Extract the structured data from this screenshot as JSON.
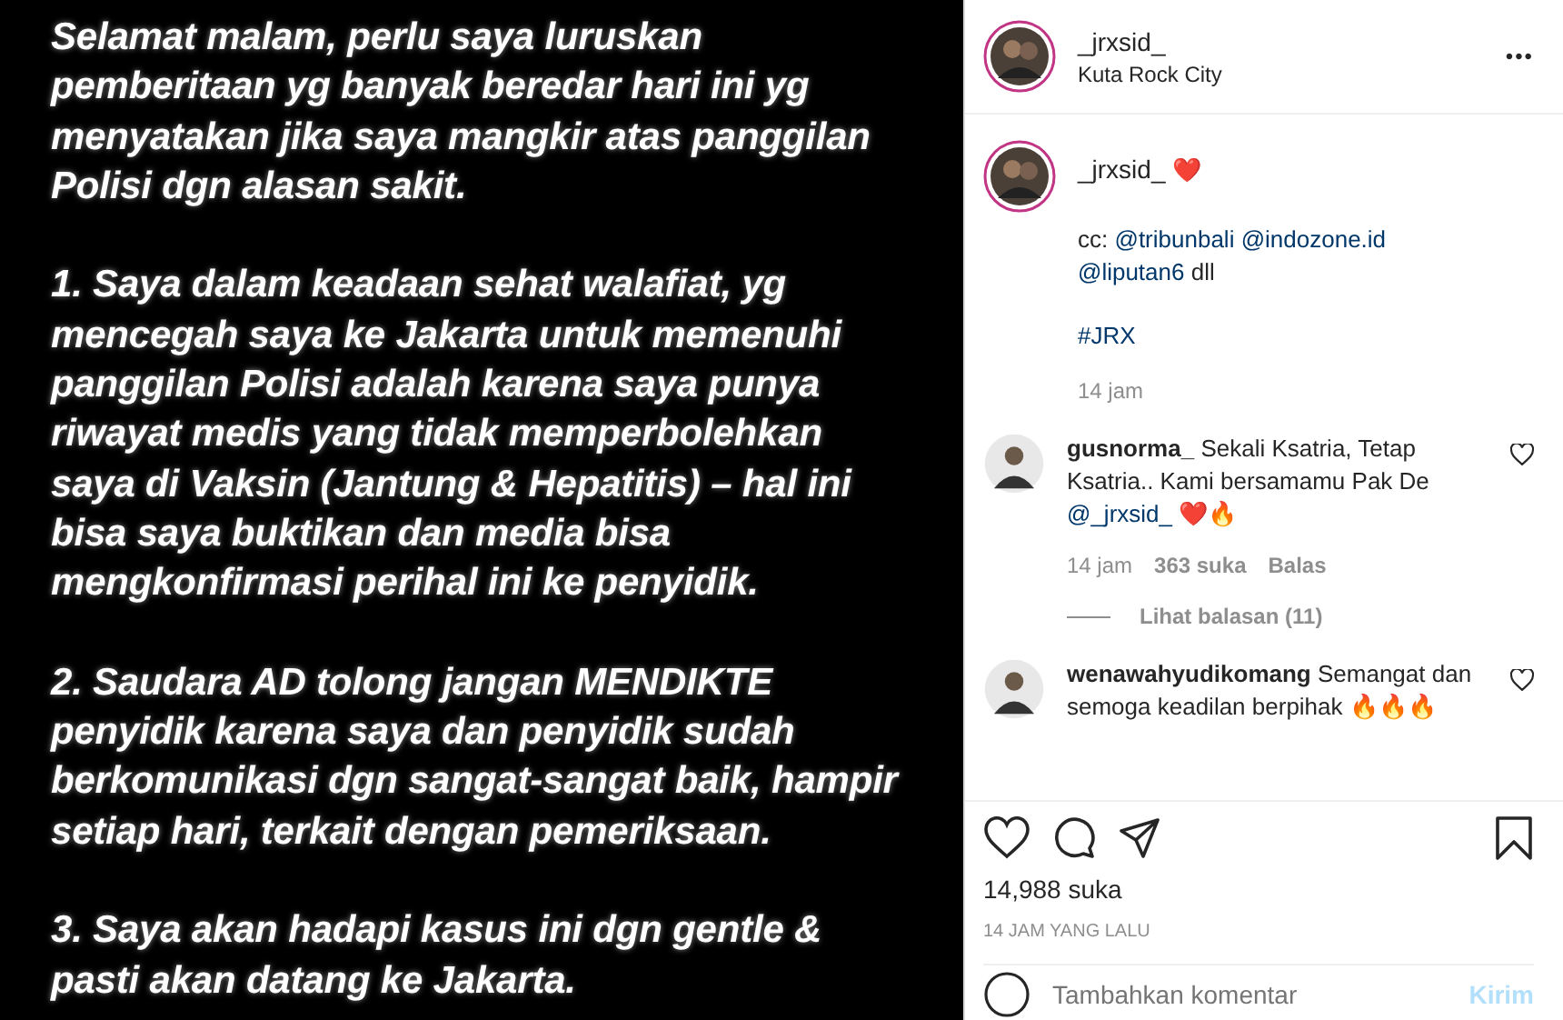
{
  "post_image": {
    "paragraphs": [
      {
        "lines": [
          "Selamat malam, perlu saya luruskan",
          "pemberitaan yg banyak beredar hari ini yg",
          "menyatakan jika saya mangkir atas panggilan",
          "Polisi dgn alasan sakit."
        ]
      },
      {
        "lines": [
          "1. Saya dalam keadaan sehat walafiat, yg",
          "mencegah saya ke Jakarta untuk memenuhi",
          "panggilan Polisi adalah karena saya punya",
          "riwayat medis yang tidak memperbolehkan",
          "saya di Vaksin (Jantung & Hepatitis) – hal ini",
          "bisa saya buktikan dan media bisa",
          "mengkonfirmasi perihal ini ke penyidik."
        ]
      },
      {
        "lines": [
          "2. Saudara AD tolong jangan MENDIKTE",
          "penyidik karena saya dan penyidik sudah",
          "berkomunikasi dgn sangat-sangat baik, hampir",
          "setiap hari, terkait dengan pemeriksaan."
        ]
      },
      {
        "lines": [
          "3. Saya akan hadapi kasus ini dgn gentle &",
          "pasti akan datang ke Jakarta."
        ]
      }
    ]
  },
  "header": {
    "username": "_jrxsid_",
    "location": "Kuta Rock City",
    "more": "•••"
  },
  "caption": {
    "username": "_jrxsid_",
    "emoji": "❤️",
    "lines": [
      [
        {
          "kind": "plain",
          "text": "cc:"
        },
        {
          "kind": "mention",
          "text": "@tribunbali"
        },
        {
          "kind": "mention",
          "text": "@indozone.id"
        }
      ],
      [
        {
          "kind": "mention",
          "text": "@liputan6"
        },
        {
          "kind": "plain",
          "text": "dll"
        }
      ]
    ],
    "hashtag": "#JRX",
    "time": "14 jam"
  },
  "comments": [
    {
      "username": "gusnorma_",
      "text": "Sekali Ksatria, Tetap Ksatria.. Kami bersamamu Pak De",
      "mention": "@_jrxsid_",
      "emoji": "❤️🔥",
      "time": "14 jam",
      "likes": "363 suka",
      "reply": "Balas",
      "view_replies": "Lihat balasan (11)",
      "liked": false
    },
    {
      "username": "wenawahyudikomang",
      "text": "Semangat dan semoga keadilan berpihak 🔥🔥🔥",
      "liked": false
    }
  ],
  "likes": "14,988 suka",
  "posted": "14 JAM YANG LALU",
  "comment_box": {
    "placeholder": "Tambahkan komentar",
    "send": "Kirim"
  }
}
